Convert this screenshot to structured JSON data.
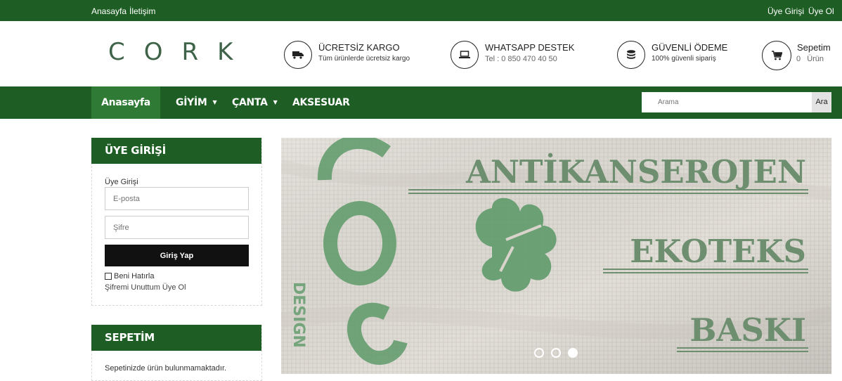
{
  "topbar": {
    "home_link": "Anasayfa",
    "contact_link": "İletişim",
    "login_link": "Üye Girişi",
    "register_link": "Üye Ol"
  },
  "header": {
    "logo": "CORK",
    "features": [
      {
        "title": "ÜCRETSİZ KARGO",
        "subtitle": "Tüm ürünlerde ücretsiz kargo",
        "icon": "truck-icon"
      },
      {
        "title": "WHATSAPP DESTEK",
        "subtitle": "Tel : 0 850 470 40 50",
        "icon": "laptop-icon"
      },
      {
        "title": "GÜVENLİ ÖDEME",
        "subtitle": "100% güvenli sipariş",
        "icon": "coins-icon"
      }
    ],
    "cart": {
      "title": "Sepetim",
      "count": "0",
      "unit": "Ürün",
      "icon": "cart-icon"
    }
  },
  "nav": {
    "items": [
      "Anasayfa",
      "GİYİM",
      "ÇANTA",
      "AKSESUAR"
    ],
    "search_placeholder": "Arama",
    "search_button": "Ara"
  },
  "login_panel": {
    "heading": "ÜYE GİRİŞİ",
    "label": "Üye Girişi",
    "email_placeholder": "E-posta",
    "password_placeholder": "Şifre",
    "submit": "Giriş Yap",
    "remember": "Beni Hatırla",
    "forgot": "Şifremi Unuttum",
    "register": "Üye Ol"
  },
  "cart_panel": {
    "heading": "SEPETİM",
    "empty_text": "Sepetinizde ürün bulunmamaktadır."
  },
  "banner": {
    "lines": [
      "ANTİKANSEROJEN",
      "EKOTEKS",
      "BASKI"
    ],
    "brand_print": "CORK",
    "brand_sub": "DESIGN",
    "active_slide": 3,
    "slide_count": 3
  },
  "colors": {
    "brand_green": "#1e5e24",
    "nav_active": "#2f7a34",
    "logo_green": "#3e6348",
    "banner_text": "#6e8e70"
  }
}
